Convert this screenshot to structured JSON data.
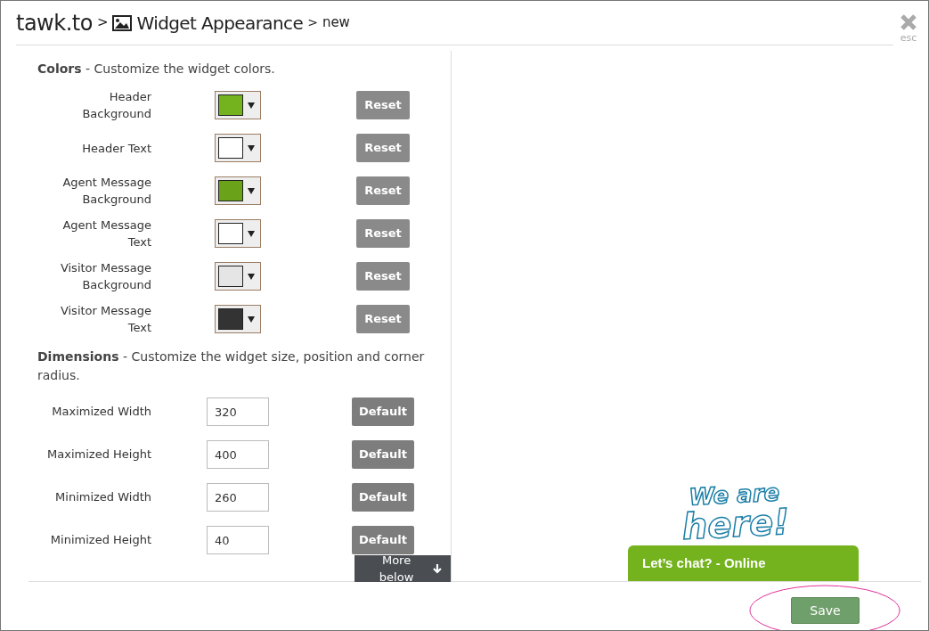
{
  "breadcrumb": {
    "brand": "tawk.to",
    "separator_1": ">",
    "page": "Widget Appearance",
    "separator_2": ">",
    "sub": "new"
  },
  "close": {
    "label": "esc"
  },
  "colors": {
    "heading": "Colors",
    "description": "- Customize the widget colors.",
    "rows": [
      {
        "label": "Header Background",
        "color": "#74b31d",
        "button": "Reset"
      },
      {
        "label": "Header Text",
        "color": "#ffffff",
        "button": "Reset"
      },
      {
        "label": "Agent Message Background",
        "color": "#6aa31a",
        "button": "Reset"
      },
      {
        "label": "Agent Message Text",
        "color": "#ffffff",
        "button": "Reset"
      },
      {
        "label": "Visitor Message Background",
        "color": "#e5e5e5",
        "button": "Reset"
      },
      {
        "label": "Visitor Message Text",
        "color": "#333333",
        "button": "Reset"
      }
    ]
  },
  "dimensions": {
    "heading": "Dimensions",
    "description": "- Customize the widget size, position and corner radius.",
    "rows": [
      {
        "label": "Maximized Width",
        "value": "320",
        "button": "Default"
      },
      {
        "label": "Maximized Height",
        "value": "400",
        "button": "Default"
      },
      {
        "label": "Minimized Width",
        "value": "260",
        "button": "Default"
      },
      {
        "label": "Minimized Height",
        "value": "40",
        "button": "Default"
      }
    ]
  },
  "more_below": "More below",
  "preview": {
    "logo_line_1": "We are",
    "logo_line_2": "here!",
    "chat_bar": "Let’s chat? - Online"
  },
  "save": "Save"
}
